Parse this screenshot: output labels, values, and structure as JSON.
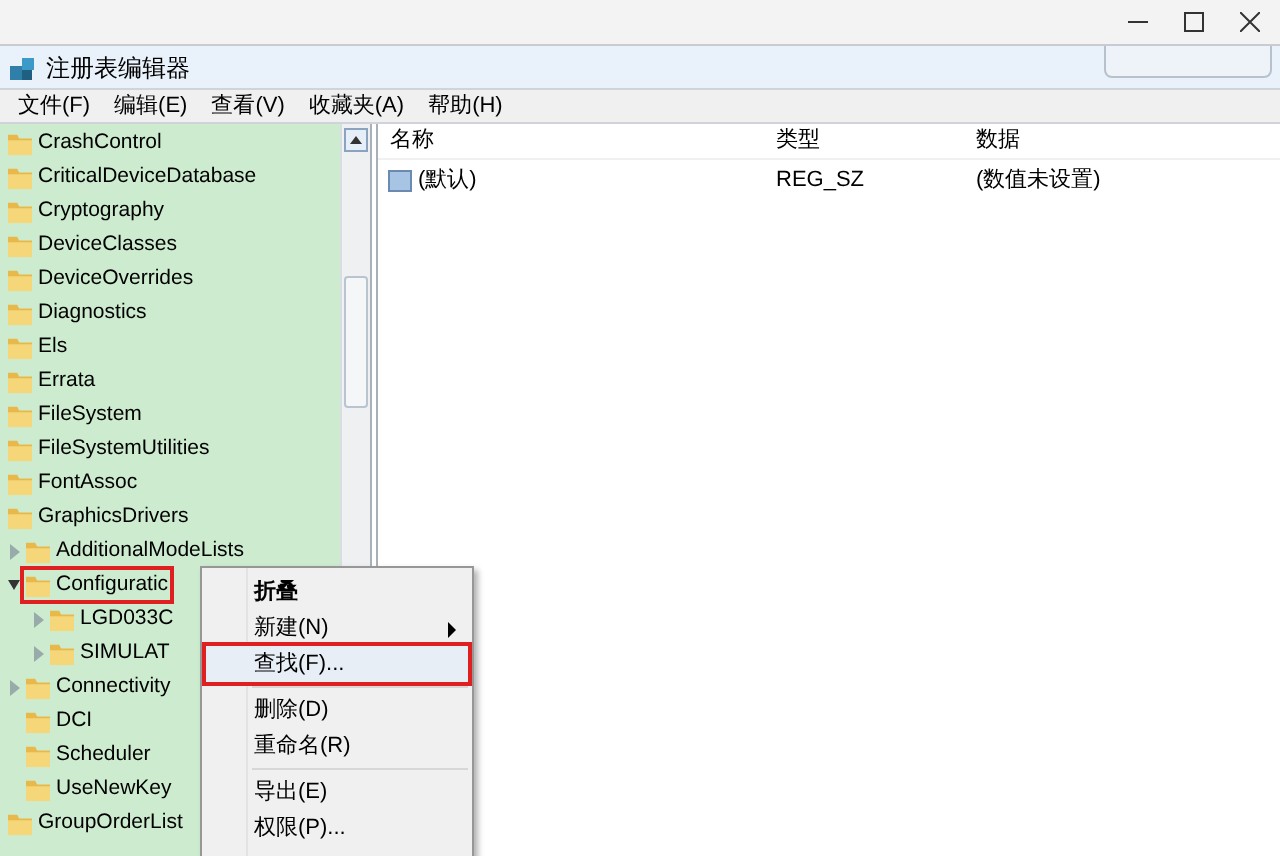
{
  "window": {
    "title": "注册表编辑器"
  },
  "menu_bar": [
    "文件(F)",
    "编辑(E)",
    "查看(V)",
    "收藏夹(A)",
    "帮助(H)"
  ],
  "tree": [
    {
      "label": "CrashControl",
      "selected": false
    },
    {
      "label": "CriticalDeviceDatabase",
      "selected": false
    },
    {
      "label": "Cryptography",
      "selected": false
    },
    {
      "label": "DeviceClasses",
      "selected": false
    },
    {
      "label": "DeviceOverrides",
      "selected": false
    },
    {
      "label": "Diagnostics",
      "selected": false
    },
    {
      "label": "Els",
      "selected": false
    },
    {
      "label": "Errata",
      "selected": false
    },
    {
      "label": "FileSystem",
      "selected": false
    },
    {
      "label": "FileSystemUtilities",
      "selected": false
    },
    {
      "label": "FontAssoc",
      "selected": false
    },
    {
      "label": "GraphicsDrivers",
      "selected": false,
      "children": [
        {
          "label": "AdditionalModeLists",
          "selected": false,
          "expanded": false
        },
        {
          "label": "Configuratic",
          "selected": true,
          "expanded": true,
          "children": [
            {
              "label": "LGD033C",
              "selected": false,
              "expanded": false
            },
            {
              "label": "SIMULAT",
              "selected": false,
              "expanded": false
            }
          ]
        },
        {
          "label": "Connectivity",
          "selected": false,
          "expanded": false
        },
        {
          "label": "DCI",
          "selected": false
        },
        {
          "label": "Scheduler",
          "selected": false
        },
        {
          "label": "UseNewKey",
          "selected": false
        }
      ]
    },
    {
      "label": "GroupOrderList",
      "selected": false
    }
  ],
  "values_table": {
    "columns": [
      "名称",
      "类型",
      "数据"
    ],
    "rows": [
      {
        "name": "(默认)",
        "type": "REG_SZ",
        "data": "(数值未设置)"
      }
    ]
  },
  "context_menu": [
    {
      "kind": "item",
      "label": "折叠",
      "selected": false,
      "bold": true
    },
    {
      "kind": "item",
      "label": "新建(N)",
      "selected": false,
      "submenu": true
    },
    {
      "kind": "item",
      "label": "查找(F)...",
      "selected": true
    },
    {
      "kind": "separator"
    },
    {
      "kind": "item",
      "label": "删除(D)",
      "selected": false
    },
    {
      "kind": "item",
      "label": "重命名(R)",
      "selected": false
    },
    {
      "kind": "separator"
    },
    {
      "kind": "item",
      "label": "导出(E)",
      "selected": false
    },
    {
      "kind": "item",
      "label": "权限(P)...",
      "selected": false
    }
  ]
}
